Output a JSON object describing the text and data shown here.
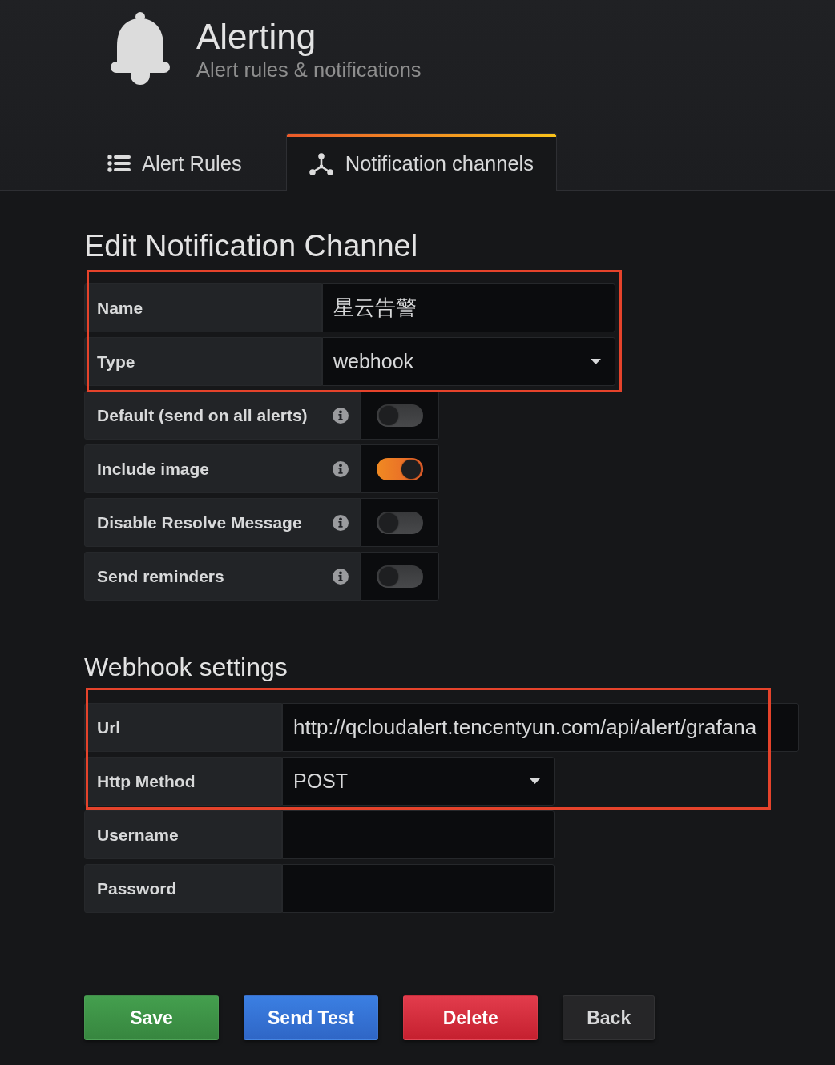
{
  "header": {
    "title": "Alerting",
    "subtitle": "Alert rules & notifications"
  },
  "tabs": [
    {
      "label": "Alert Rules",
      "selected": false
    },
    {
      "label": "Notification channels",
      "selected": true
    }
  ],
  "sections": [
    {
      "title": "Edit Notification Channel",
      "groups": [
        {
          "highlighted": true,
          "fields": [
            {
              "kind": "text",
              "label": "Name",
              "value": "星云告警"
            },
            {
              "kind": "select",
              "label": "Type",
              "value": "webhook"
            }
          ]
        },
        {
          "highlighted": false,
          "fields": [
            {
              "kind": "toggle",
              "label": "Default (send on all alerts)",
              "on": false
            },
            {
              "kind": "toggle",
              "label": "Include image",
              "on": true
            },
            {
              "kind": "toggle",
              "label": "Disable Resolve Message",
              "on": false
            },
            {
              "kind": "toggle",
              "label": "Send reminders",
              "on": false
            }
          ]
        }
      ]
    },
    {
      "title": "Webhook settings",
      "groups": [
        {
          "highlighted": true,
          "fields": [
            {
              "kind": "url",
              "label": "Url",
              "value": "http://qcloudalert.tencentyun.com/api/alert/grafana"
            },
            {
              "kind": "select",
              "label": "Http Method",
              "value": "POST"
            }
          ]
        },
        {
          "highlighted": false,
          "fields": [
            {
              "kind": "text",
              "label": "Username"
            },
            {
              "kind": "password",
              "label": "Password"
            }
          ]
        }
      ]
    }
  ],
  "buttons": [
    {
      "label": "Save",
      "kind": "success"
    },
    {
      "label": "Send Test",
      "kind": "primary"
    },
    {
      "label": "Delete",
      "kind": "danger"
    },
    {
      "label": "Back",
      "kind": "secondary"
    }
  ]
}
